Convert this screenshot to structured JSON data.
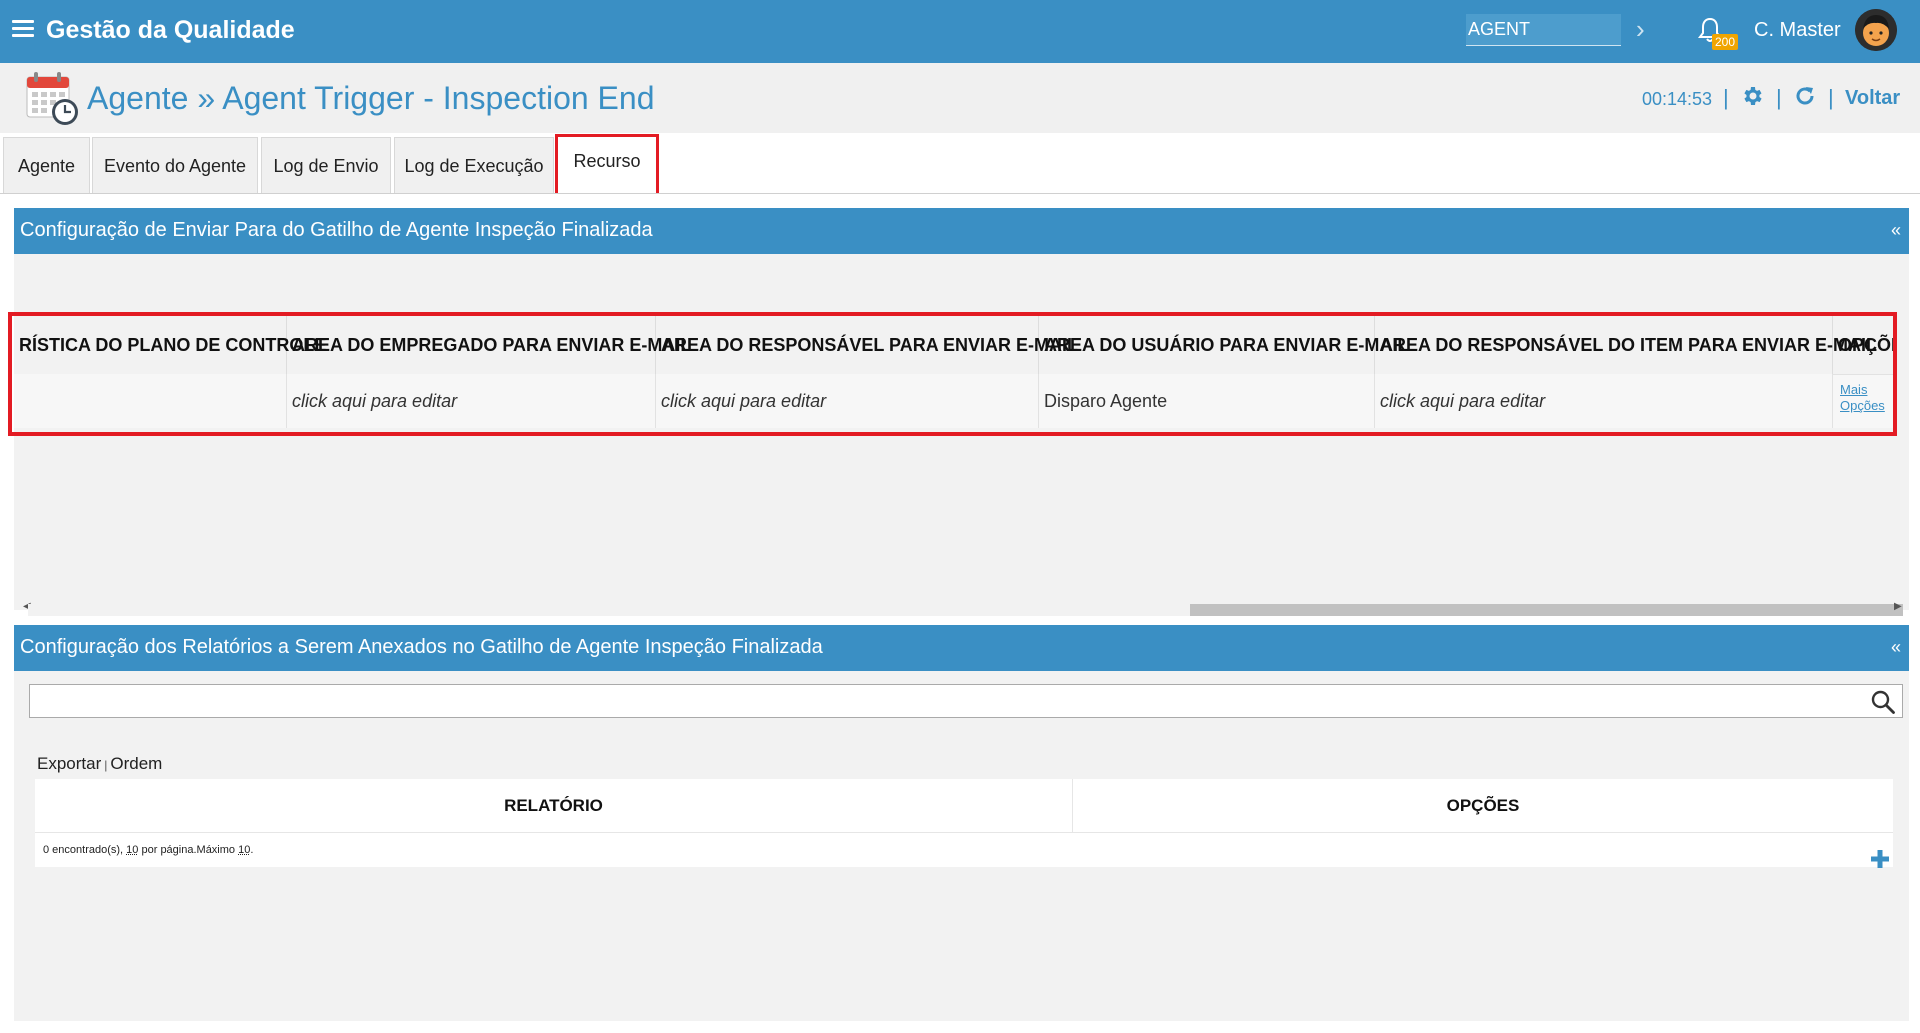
{
  "header": {
    "app_title": "Gestão da Qualidade",
    "agent_select_value": "AGENT",
    "notification_count": "200",
    "user_name": "C. Master"
  },
  "titlebar": {
    "title": "Agente » Agent Trigger - Inspection End",
    "timer": "00:14:53",
    "back_label": "Voltar"
  },
  "tabs": [
    {
      "label": "Agente"
    },
    {
      "label": "Evento do Agente"
    },
    {
      "label": "Log de Envio"
    },
    {
      "label": "Log de Execução"
    },
    {
      "label": "Recurso"
    }
  ],
  "panel1": {
    "title": "Configuração de Enviar Para do Gatilho de Agente Inspeção Finalizada",
    "columns": [
      "RÍSTICA DO PLANO DE CONTROLE",
      "AREA DO EMPREGADO PARA ENVIAR E-MAIL",
      "AREA DO RESPONSÁVEL PARA ENVIAR E-MAIL",
      "AREA DO USUÁRIO PARA ENVIAR E-MAIL",
      "AREA DO RESPONSÁVEL DO ITEM PARA ENVIAR E-MAIL",
      "OPÇÕES"
    ],
    "row": {
      "col1": "",
      "col2": "click aqui para editar",
      "col3": "click aqui para editar",
      "col4": "Disparo Agente",
      "col5": "click aqui para editar",
      "options_link": "Mais Opções"
    }
  },
  "panel2": {
    "title": "Configuração dos Relatórios a Serem Anexados no Gatilho de Agente Inspeção Finalizada",
    "search_value": "",
    "export_label": "Exportar",
    "order_label": "Ordem",
    "columns": [
      "RELATÓRIO",
      "OPÇÕES"
    ],
    "footer": {
      "found": "0 encontrado(s),",
      "per_page_count": "10",
      "per_page_text": "por página.Máximo",
      "max": "10",
      "dot": "."
    }
  },
  "colors": {
    "brand": "#3a8fc4",
    "highlight": "#e31b23",
    "badge": "#f0a500"
  }
}
